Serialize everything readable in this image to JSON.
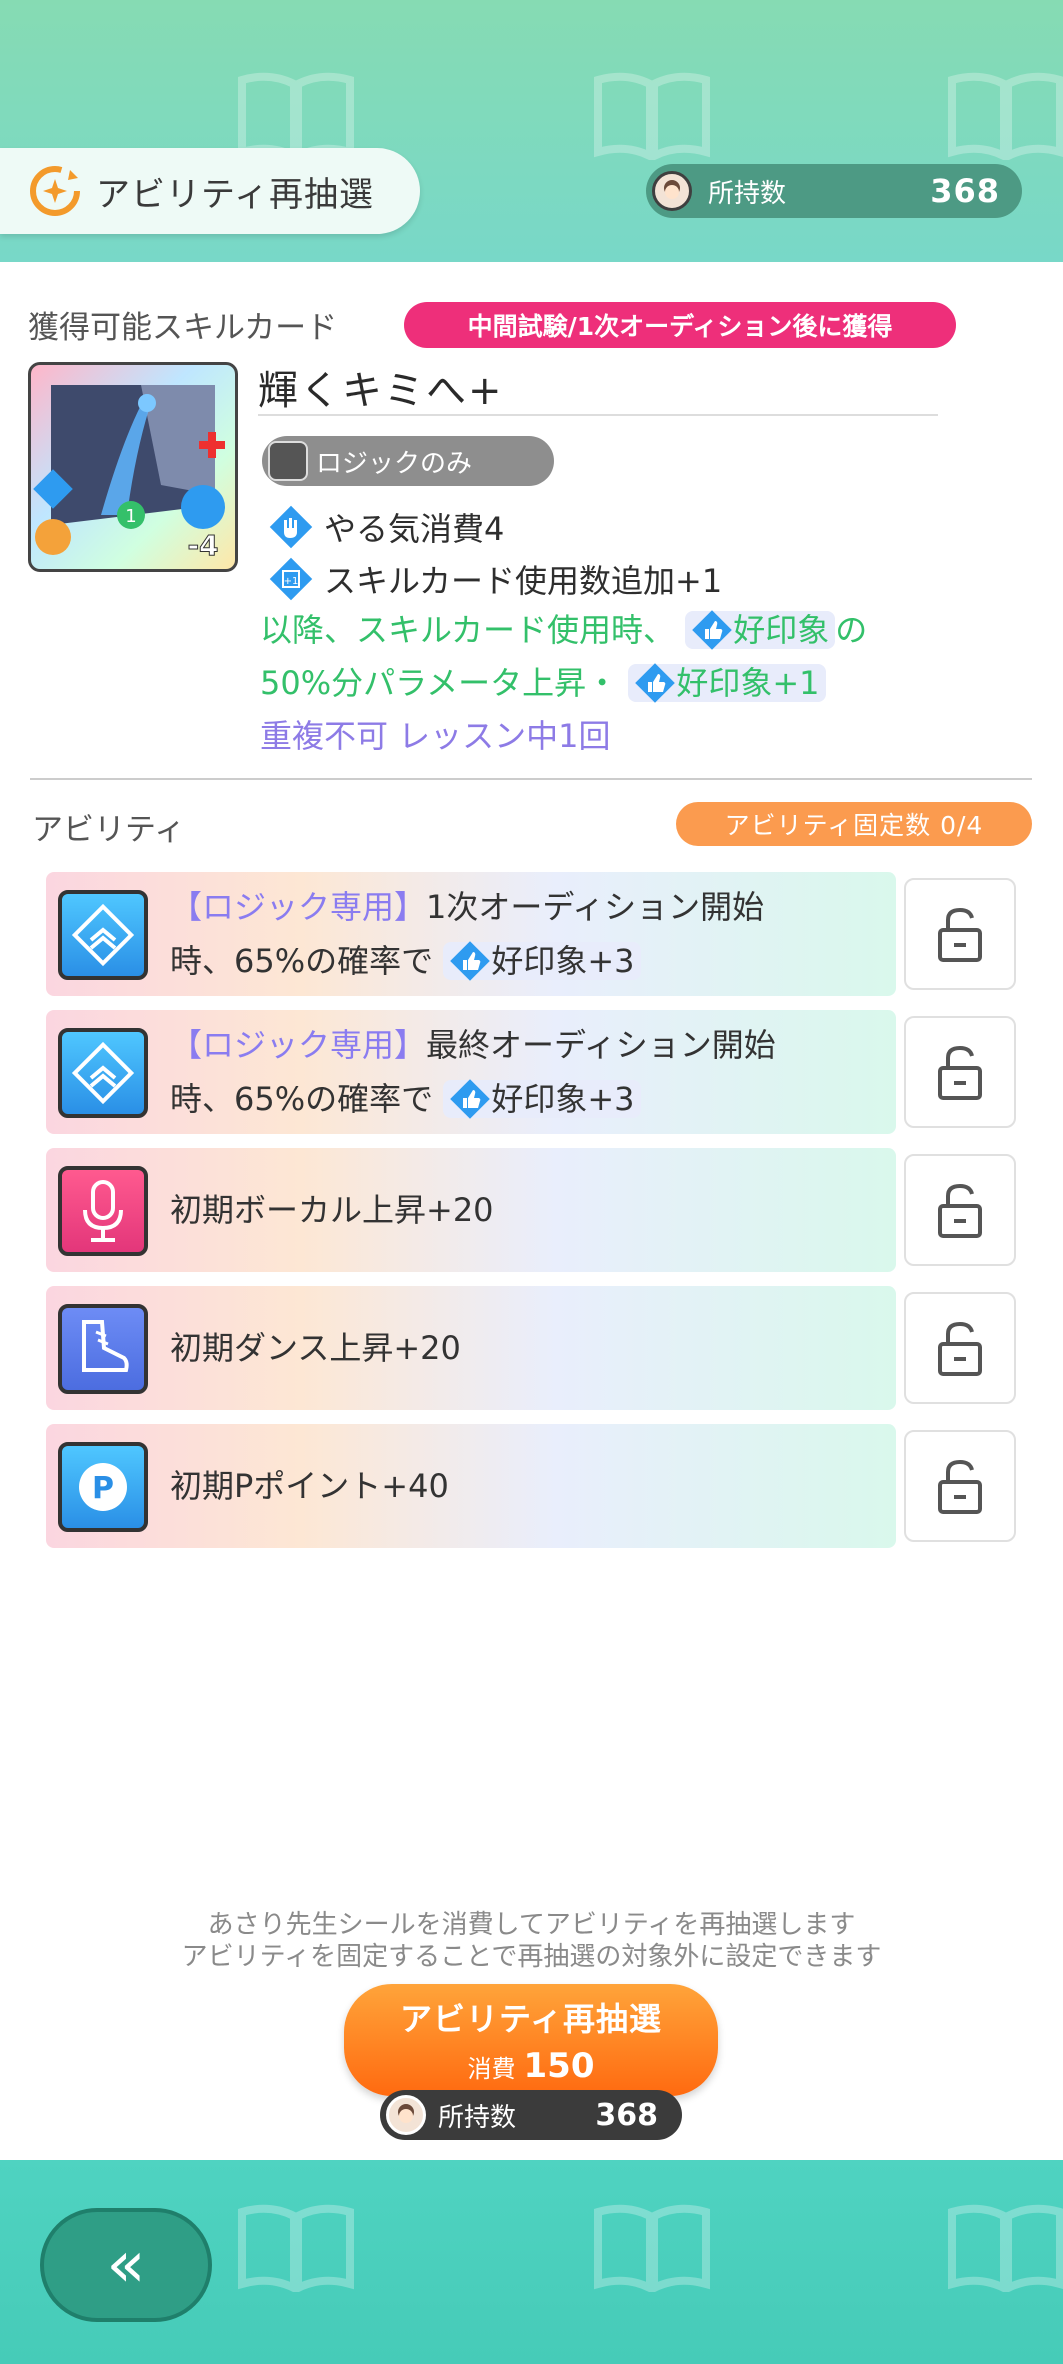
{
  "header": {
    "title": "アビリティ再抽選",
    "count_label": "所持数",
    "count_value": "368"
  },
  "skill_card": {
    "section_label": "獲得可能スキルカード",
    "acquire_tag": "中間試験/1次オーディション後に獲得",
    "name": "輝くキミへ+",
    "plan_tag": "ロジックのみ",
    "art_cost_badge": "-4",
    "art_count_badge": "1",
    "effects": [
      {
        "icon": "motivation-icon",
        "text": "やる気消費4"
      },
      {
        "icon": "skill-card-plus-icon",
        "text": "スキルカード使用数追加+1"
      }
    ],
    "desc_line1_a": "以降、スキルカード使用時、",
    "desc_impression": "好印象",
    "desc_line1_b": "の",
    "desc_line2_a": "50%分パラメータ上昇・",
    "desc_impression2": "好印象+1",
    "desc_line3": "重複不可 レッスン中1回"
  },
  "ability": {
    "section_label": "アビリティ",
    "fixed_tag": "アビリティ固定数 0/4",
    "items": [
      {
        "icon": "logic-diamond-icon",
        "tag": "【ロジック専用】",
        "line1": "1次オーディション開始",
        "line2_a": "時、65%の確率で",
        "line2_b": "好印象+3"
      },
      {
        "icon": "logic-diamond-icon",
        "tag": "【ロジック専用】",
        "line1": "最終オーディション開始",
        "line2_a": "時、65%の確率で",
        "line2_b": "好印象+3"
      },
      {
        "icon": "microphone-icon",
        "text": "初期ボーカル上昇+20"
      },
      {
        "icon": "dance-shoe-icon",
        "text": "初期ダンス上昇+20"
      },
      {
        "icon": "p-point-icon",
        "text": "初期Pポイント+40"
      }
    ]
  },
  "notice": {
    "line1": "あさり先生シールを消費してアビリティを再抽選します",
    "line2": "アビリティを固定することで再抽選の対象外に設定できます"
  },
  "reroll_button": {
    "label": "アビリティ再抽選",
    "cost_label": "消費",
    "cost_value": "150"
  },
  "footer_count": {
    "label": "所持数",
    "value": "368"
  },
  "back_button": {
    "label": "«"
  },
  "colors": {
    "accent_pink": "#ee2f7a",
    "accent_orange": "#fb9b4f",
    "impression_green": "#33c06a",
    "logic_purple": "#8d7be6",
    "band_teal": "#4fd3c1"
  }
}
